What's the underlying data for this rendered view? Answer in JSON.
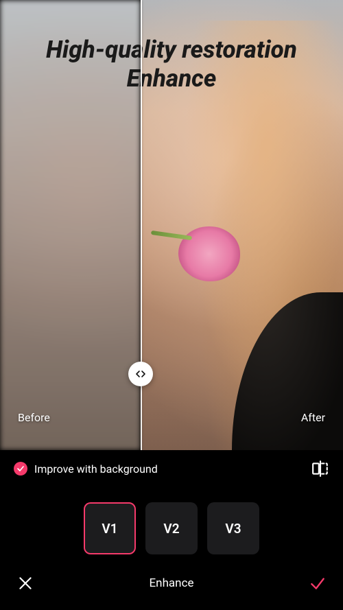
{
  "headline": {
    "line1": "High-quality restoration",
    "line2": "Enhance"
  },
  "comparison": {
    "before_label": "Before",
    "after_label": "After",
    "slider_position_percent": 41
  },
  "option": {
    "label": "Improve with background",
    "checked": true
  },
  "versions": [
    {
      "label": "V1",
      "selected": true
    },
    {
      "label": "V2",
      "selected": false
    },
    {
      "label": "V3",
      "selected": false
    }
  ],
  "footer": {
    "title": "Enhance"
  },
  "colors": {
    "accent": "#f63a6b",
    "card": "#1c1c1e"
  }
}
